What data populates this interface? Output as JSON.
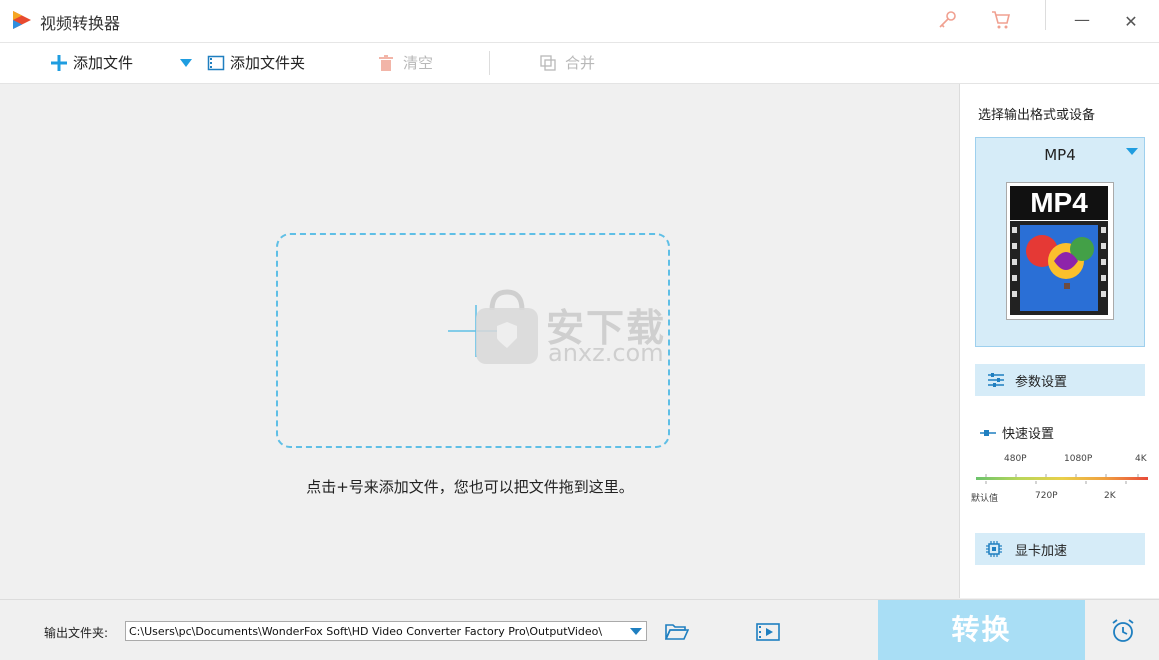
{
  "window": {
    "title": "视频转换器",
    "minimize_label": "—",
    "close_label": "✕"
  },
  "toolbar": {
    "add_file": "添加文件",
    "add_folder": "添加文件夹",
    "clear": "清空",
    "merge": "合并"
  },
  "main": {
    "hint": "点击+号来添加文件，您也可以把文件拖到这里。",
    "watermark_text": "安下载",
    "watermark_sub": "anxz.com"
  },
  "right_panel": {
    "title": "选择输出格式或设备",
    "format": "MP4",
    "thumb_label": "MP4",
    "param_settings": "参数设置",
    "quick_settings": "快速设置",
    "quality_top": [
      "480P",
      "1080P",
      "4K"
    ],
    "quality_bottom": [
      "默认值",
      "720P",
      "2K"
    ],
    "gpu_accel": "显卡加速"
  },
  "bottom": {
    "output_label": "输出文件夹:",
    "output_path": "C:\\Users\\pc\\Documents\\WonderFox Soft\\HD Video Converter Factory Pro\\OutputVideo\\",
    "convert": "转换"
  },
  "colors": {
    "accent": "#1f9de0",
    "dashed_border": "#5fbfe6",
    "panel_highlight": "#d6ecf8",
    "convert_bg": "#a9def5"
  }
}
